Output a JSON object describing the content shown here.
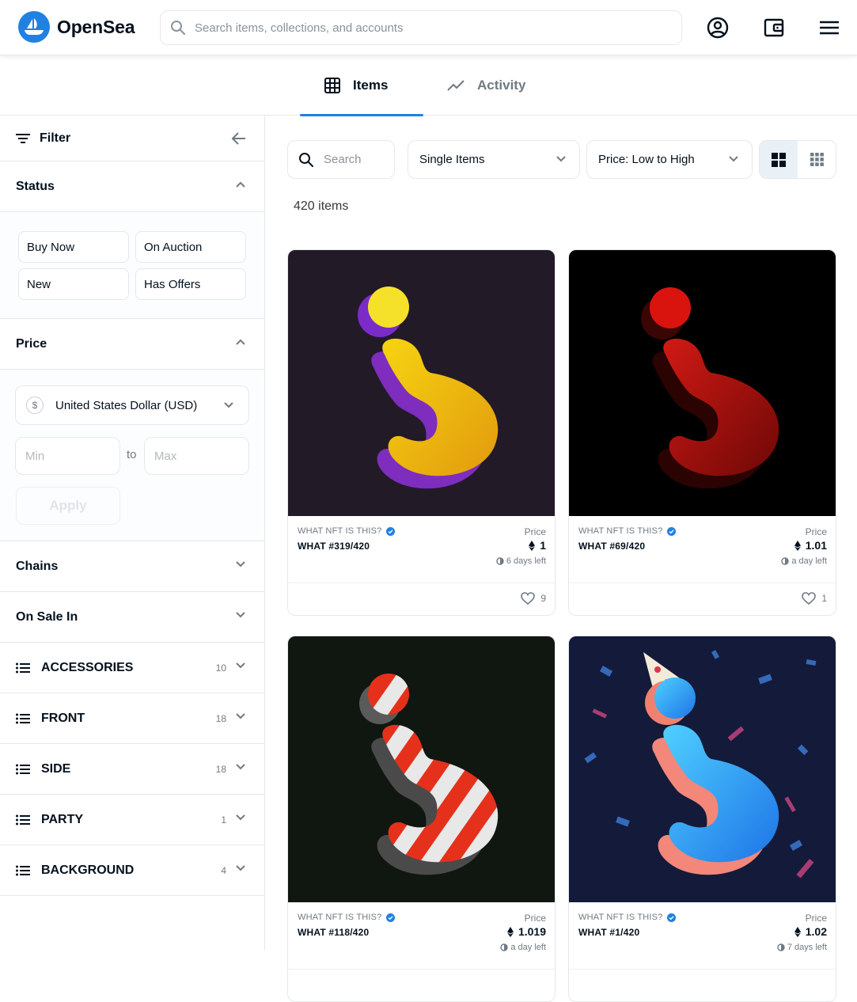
{
  "header": {
    "brand": "OpenSea",
    "search_placeholder": "Search items, collections, and accounts",
    "icons": [
      "profile-icon",
      "wallet-icon",
      "menu-icon"
    ]
  },
  "tabs": [
    {
      "label": "Items",
      "icon": "grid-icon",
      "active": true
    },
    {
      "label": "Activity",
      "icon": "activity-icon",
      "active": false
    }
  ],
  "sidebar": {
    "filter_label": "Filter",
    "status": {
      "title": "Status",
      "options": [
        "Buy Now",
        "On Auction",
        "New",
        "Has Offers"
      ]
    },
    "price": {
      "title": "Price",
      "currency": "United States Dollar (USD)",
      "currency_symbol": "$",
      "min_placeholder": "Min",
      "to_label": "to",
      "max_placeholder": "Max",
      "apply_label": "Apply"
    },
    "chains_title": "Chains",
    "on_sale_in_title": "On Sale In",
    "traits": [
      {
        "label": "ACCESSORIES",
        "count": "10"
      },
      {
        "label": "FRONT",
        "count": "18"
      },
      {
        "label": "SIDE",
        "count": "18"
      },
      {
        "label": "PARTY",
        "count": "1"
      },
      {
        "label": "BACKGROUND",
        "count": "4"
      }
    ]
  },
  "toolbar": {
    "search_placeholder": "Search",
    "type_select": "Single Items",
    "sort_select": "Price: Low to High",
    "view_modes": [
      "large-grid",
      "small-grid"
    ]
  },
  "item_count": "420 items",
  "items": [
    {
      "collection": "WHAT NFT IS THIS?",
      "name": "WHAT #319/420",
      "price_label": "Price",
      "price": "1",
      "time_left": "6 days left",
      "likes": "9"
    },
    {
      "collection": "WHAT NFT IS THIS?",
      "name": "WHAT #69/420",
      "price_label": "Price",
      "price": "1.01",
      "time_left": "a day left",
      "likes": "1"
    },
    {
      "collection": "WHAT NFT IS THIS?",
      "name": "WHAT #118/420",
      "price_label": "Price",
      "price": "1.019",
      "time_left": "a day left",
      "likes": ""
    },
    {
      "collection": "WHAT NFT IS THIS?",
      "name": "WHAT #1/420",
      "price_label": "Price",
      "price": "1.02",
      "time_left": "7 days left",
      "likes": ""
    }
  ],
  "colors": {
    "accent": "#2081e2",
    "text": "#04111d",
    "muted": "#707a83",
    "border": "#e5e8eb"
  }
}
